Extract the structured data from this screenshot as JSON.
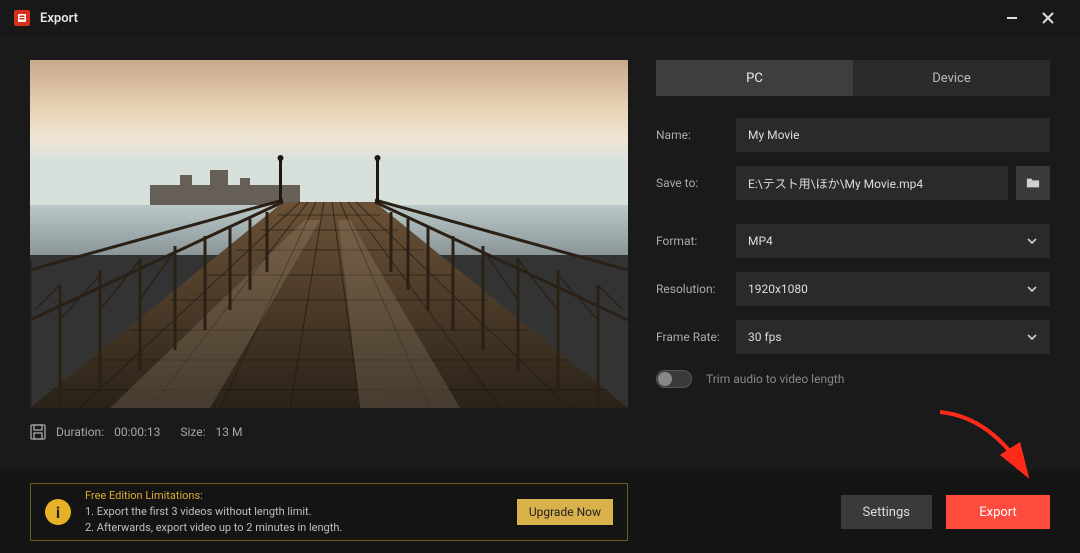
{
  "window": {
    "title": "Export"
  },
  "tabs": {
    "pc": "PC",
    "device": "Device",
    "active": "pc"
  },
  "form": {
    "name_label": "Name:",
    "name_value": "My Movie",
    "saveto_label": "Save to:",
    "saveto_value": "E:\\テスト用\\ほか\\My Movie.mp4",
    "format_label": "Format:",
    "format_value": "MP4",
    "resolution_label": "Resolution:",
    "resolution_value": "1920x1080",
    "framerate_label": "Frame Rate:",
    "framerate_value": "30 fps"
  },
  "toggle": {
    "label": "Trim audio to video length",
    "on": false
  },
  "meta": {
    "duration_label": "Duration:",
    "duration_value": "00:00:13",
    "size_label": "Size:",
    "size_value": "13 M"
  },
  "limitations": {
    "heading": "Free Edition Limitations:",
    "line1": "1. Export the first 3 videos without length limit.",
    "line2": "2. Afterwards, export video up to 2 minutes in length.",
    "upgrade": "Upgrade Now"
  },
  "buttons": {
    "settings": "Settings",
    "export": "Export"
  },
  "icons": {
    "folder": "folder-icon",
    "chevron": "chevron-down-icon",
    "minimize": "minimize-icon",
    "close": "close-icon",
    "info": "i",
    "disk": "disk-icon",
    "logo": "app-logo-icon"
  }
}
